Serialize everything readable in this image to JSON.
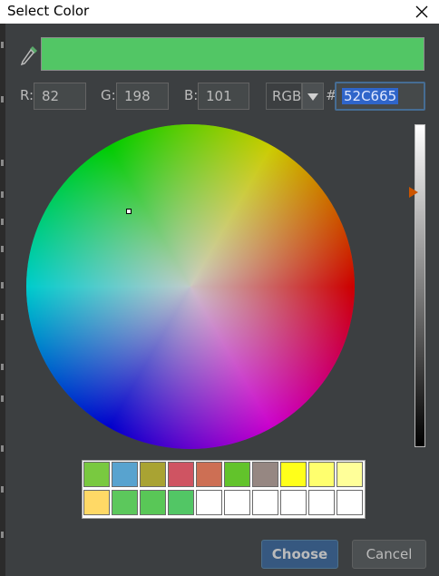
{
  "window": {
    "title": "Select Color"
  },
  "preview": {
    "color": "#52c665"
  },
  "components": {
    "r_label": "R:",
    "r_value": "82",
    "g_label": "G:",
    "g_value": "198",
    "b_label": "B:",
    "b_value": "101"
  },
  "mode": {
    "selected": "RGB"
  },
  "hex": {
    "hash_label": "#",
    "value": "52C665"
  },
  "brightness": {
    "level": 0.79
  },
  "swatches": {
    "row1": [
      "#79c940",
      "#58a3cf",
      "#a9a333",
      "#cf5462",
      "#cd6f54",
      "#62c32b",
      "#968782",
      "#ffff1a",
      "#ffff6e",
      "#ffff99"
    ],
    "row2": [
      "#ffd966",
      "#5cc85c",
      "#59c757",
      "#52c665",
      "#ffffff",
      "#ffffff",
      "#ffffff",
      "#ffffff",
      "#ffffff",
      "#ffffff"
    ]
  },
  "buttons": {
    "choose_label": "Choose",
    "cancel_label": "Cancel"
  },
  "icons": {
    "eyedropper": "eyedropper-icon",
    "close": "close-icon",
    "dropdown": "chevron-down-icon"
  }
}
